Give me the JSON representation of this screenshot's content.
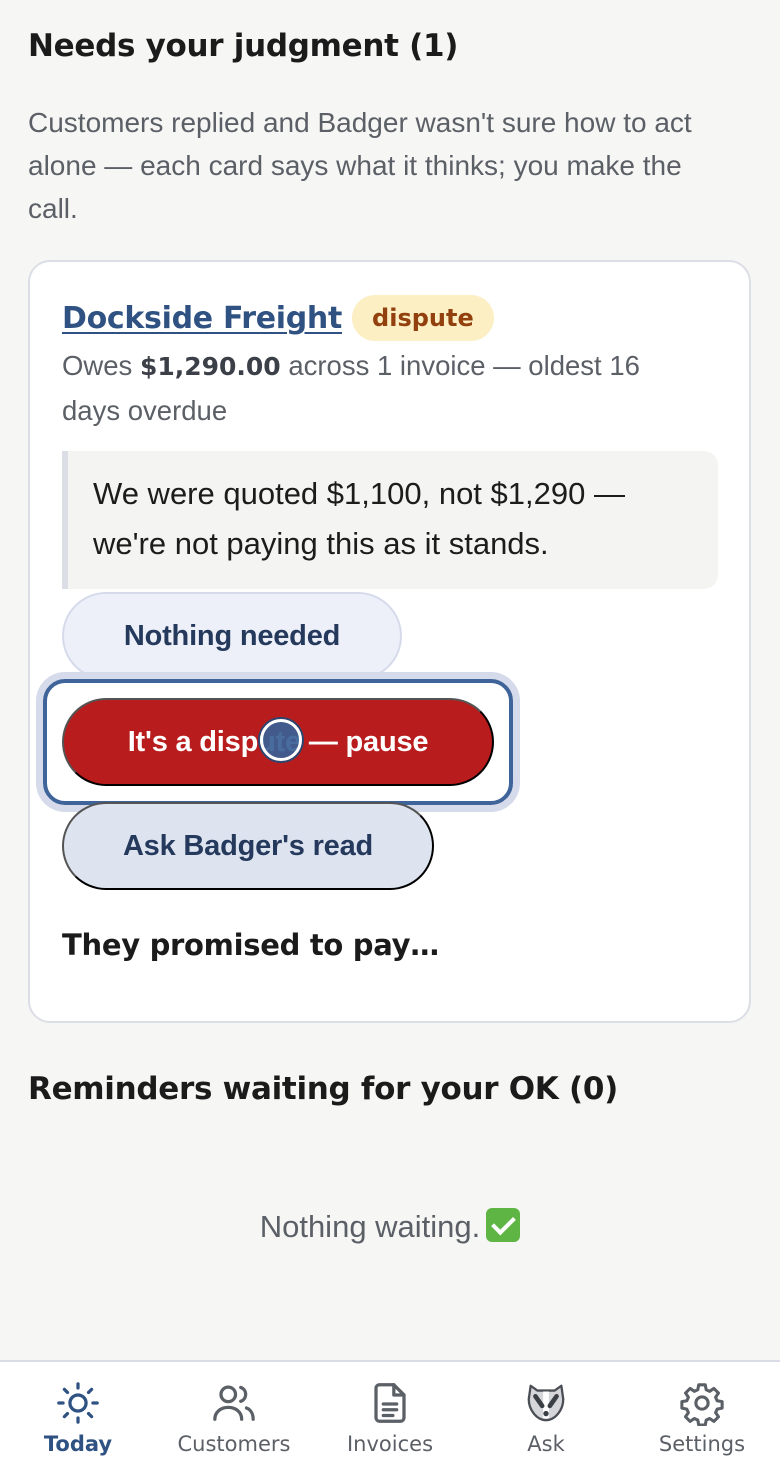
{
  "judgment": {
    "title": "Needs your judgment (1)",
    "intro": "Customers replied and Badger wasn't sure how to act alone — each card says what it thinks; you make the call."
  },
  "card": {
    "customer": "Dockside Freight",
    "badge": "dispute",
    "owes_prefix": "Owes ",
    "owes_amount": "$1,290.00",
    "owes_suffix": " across 1 invoice — oldest 16 days overdue",
    "quote": "We were quoted $1,100, not $1,290 — we're not paying this as it stands.",
    "actions": {
      "nothing": "Nothing needed",
      "dispute": "It's a dispute — pause",
      "ask": "Ask Badger's read"
    },
    "promised": "They promised to pay…"
  },
  "reminders": {
    "title": "Reminders waiting for your OK (0)",
    "empty": "Nothing waiting."
  },
  "tabs": [
    {
      "label": "Today",
      "icon": "sun-icon",
      "active": true
    },
    {
      "label": "Customers",
      "icon": "users-icon",
      "active": false
    },
    {
      "label": "Invoices",
      "icon": "document-icon",
      "active": false
    },
    {
      "label": "Ask",
      "icon": "badger-icon",
      "active": false
    },
    {
      "label": "Settings",
      "icon": "gear-icon",
      "active": false
    }
  ],
  "colors": {
    "accent": "#2f5283",
    "danger": "#b91c1c",
    "badge_bg": "#fcefc4",
    "badge_text": "#92400e"
  }
}
